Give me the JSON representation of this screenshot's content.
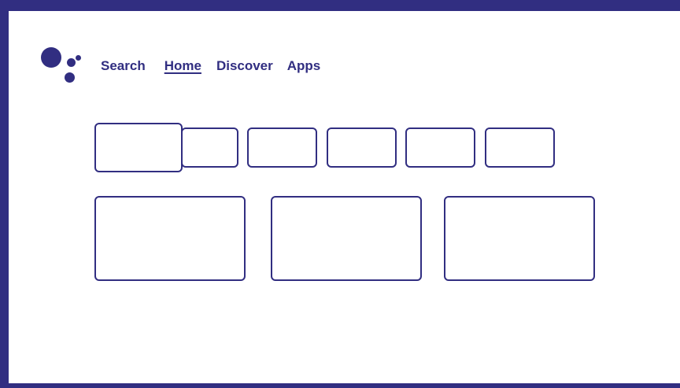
{
  "colors": {
    "accent": "#312e81",
    "background": "#ffffff"
  },
  "assistant": {
    "icon": "google-assistant-icon"
  },
  "nav": {
    "items": [
      {
        "label": "Search",
        "active": false
      },
      {
        "label": "Home",
        "active": true
      },
      {
        "label": "Discover",
        "active": false
      },
      {
        "label": "Apps",
        "active": false
      }
    ]
  },
  "rows": {
    "top_row_card_count": 6,
    "bottom_row_card_count": 3,
    "focused_card": "top-row-card-1"
  }
}
